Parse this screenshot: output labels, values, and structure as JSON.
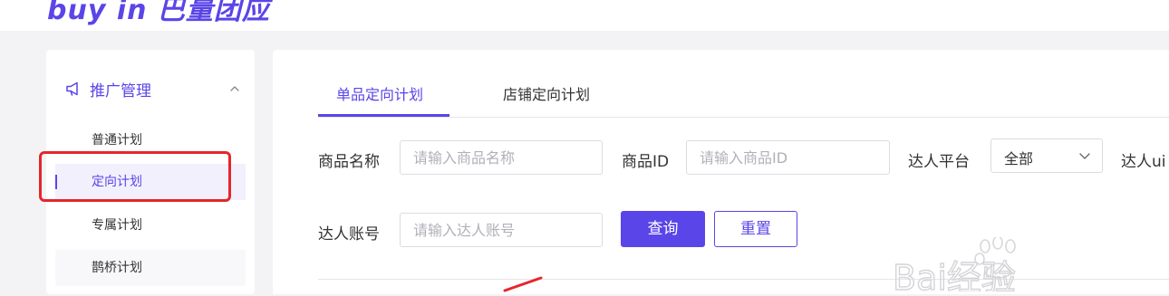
{
  "brand": {
    "logo_text": "buy in 巴量团应"
  },
  "sidebar": {
    "group_label": "推广管理",
    "items": [
      {
        "label": "普通计划"
      },
      {
        "label": "定向计划"
      },
      {
        "label": "专属计划"
      },
      {
        "label": "鹊桥计划"
      }
    ]
  },
  "tabs": [
    {
      "label": "单品定向计划",
      "active": true
    },
    {
      "label": "店铺定向计划",
      "active": false
    }
  ],
  "filters": {
    "product_name": {
      "label": "商品名称",
      "placeholder": "请输入商品名称"
    },
    "product_id": {
      "label": "商品ID",
      "placeholder": "请输入商品ID"
    },
    "platform": {
      "label": "达人平台",
      "value": "全部"
    },
    "uid_label_partial": "达人ui",
    "account": {
      "label": "达人账号",
      "placeholder": "请输入达人账号"
    }
  },
  "buttons": {
    "query": "查询",
    "reset": "重置"
  },
  "watermark": {
    "text": "Bai经验"
  },
  "colors": {
    "accent": "#5a45e8",
    "active_bg": "#f2f0fd",
    "highlight": "#e5262b"
  },
  "icons": {
    "group": "megaphone-icon",
    "collapse": "chevron-up-icon",
    "select": "chevron-down-icon"
  }
}
